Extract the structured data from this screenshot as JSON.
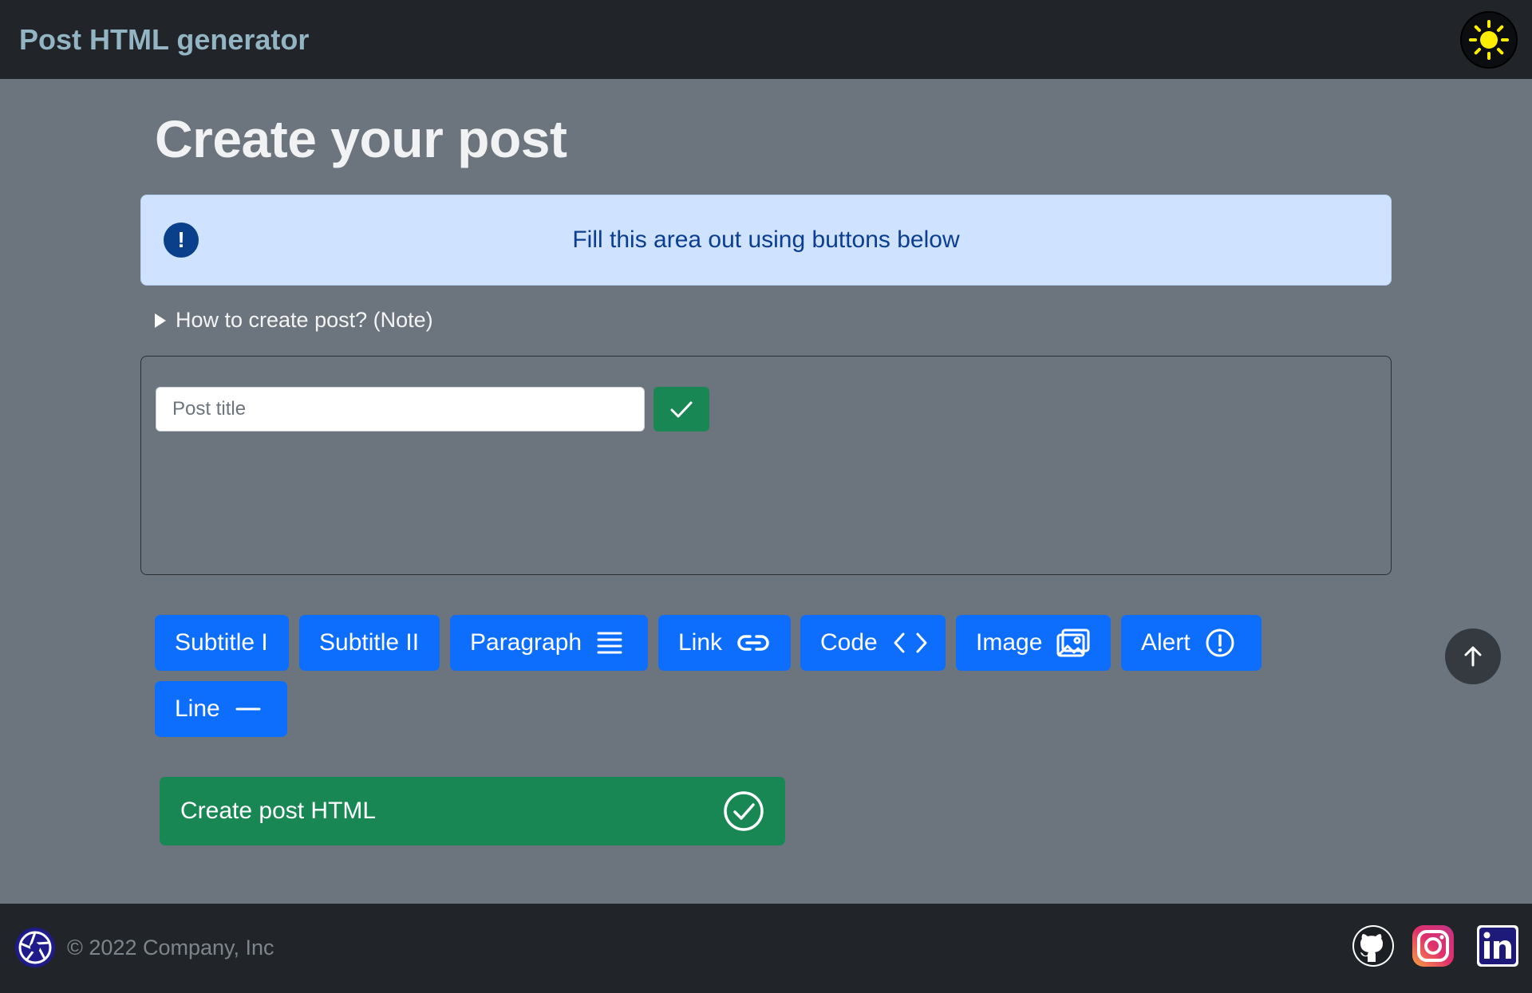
{
  "header": {
    "brand": "Post HTML generator",
    "theme_toggle_icon": "sun-icon"
  },
  "main": {
    "title": "Create your post",
    "alert": {
      "icon": "exclamation-circle-icon",
      "text": "Fill this area out using buttons below"
    },
    "note_summary": "How to create post? (Note)",
    "title_input": {
      "placeholder": "Post title",
      "value": ""
    },
    "toolbar": [
      {
        "label": "Subtitle I",
        "icon": ""
      },
      {
        "label": "Subtitle II",
        "icon": ""
      },
      {
        "label": "Paragraph",
        "icon": "text-lines-icon"
      },
      {
        "label": "Link",
        "icon": "link-icon"
      },
      {
        "label": "Code",
        "icon": "code-icon"
      },
      {
        "label": "Image",
        "icon": "image-icon"
      },
      {
        "label": "Alert",
        "icon": "exclamation-circle-icon"
      },
      {
        "label": "Line",
        "icon": "dash-icon"
      }
    ],
    "create_button": "Create post HTML"
  },
  "footer": {
    "copyright": "© 2022 Company, Inc",
    "social": [
      "github-icon",
      "instagram-icon",
      "linkedin-icon"
    ]
  },
  "colors": {
    "primary": "#0d6efd",
    "success": "#198754",
    "dark": "#212529",
    "background": "#6c757d",
    "alert_bg": "#cfe2ff"
  }
}
